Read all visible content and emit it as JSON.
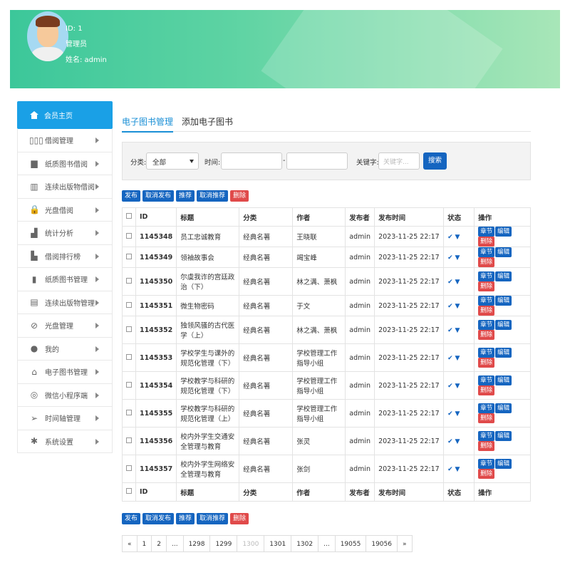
{
  "user": {
    "id_text": "ID: 1",
    "role": "管理员",
    "name_text": "姓名:  admin"
  },
  "sidebar": {
    "home": "会员主页",
    "items": [
      {
        "label": "借阅管理",
        "icon": "books-icon"
      },
      {
        "label": "纸质图书借阅",
        "icon": "book-icon"
      },
      {
        "label": "连续出版物借阅",
        "icon": "shelf-icon"
      },
      {
        "label": "光盘借阅",
        "icon": "lock-icon"
      },
      {
        "label": "统计分析",
        "icon": "chart-icon"
      },
      {
        "label": "借阅排行榜",
        "icon": "ranking-icon"
      },
      {
        "label": "纸质图书管理",
        "icon": "bookmark-icon"
      },
      {
        "label": "连续出版物管理",
        "icon": "doc-edit-icon"
      },
      {
        "label": "光盘管理",
        "icon": "disc-icon"
      },
      {
        "label": "我的",
        "icon": "user-icon"
      },
      {
        "label": "电子图书管理",
        "icon": "open-book-icon"
      },
      {
        "label": "微信小程序端",
        "icon": "wechat-icon"
      },
      {
        "label": "时间轴管理",
        "icon": "send-icon"
      },
      {
        "label": "系统设置",
        "icon": "gear-icon"
      }
    ]
  },
  "tabs": {
    "active": "电子图书管理",
    "second": "添加电子图书"
  },
  "filter": {
    "category_label": "分类:",
    "category_value": "全部",
    "time_label": "时间:",
    "dash": "-",
    "keyword_label": "关键字:",
    "keyword_placeholder": "关键字...",
    "search_button": "搜索"
  },
  "actions": {
    "publish": "发布",
    "unpublish": "取消发布",
    "recommend": "推荐",
    "unrecommend": "取消推荐",
    "delete": "删除"
  },
  "table": {
    "headers": {
      "id": "ID",
      "title": "标题",
      "category": "分类",
      "author": "作者",
      "publisher": "发布者",
      "time": "发布时间",
      "status": "状态",
      "ops": "操作"
    },
    "op_labels": {
      "chapter": "章节",
      "edit": "编辑",
      "delete": "删除"
    },
    "rows": [
      {
        "id": "1145348",
        "title": "员工忠诚教育",
        "category": "经典名著",
        "author": "王晓联",
        "publisher": "admin",
        "time": "2023-11-25 22:17"
      },
      {
        "id": "1145349",
        "title": "领袖故事会",
        "category": "经典名著",
        "author": "竭宝峰",
        "publisher": "admin",
        "time": "2023-11-25 22:17"
      },
      {
        "id": "1145350",
        "title": "尔虞我诈的宫廷政治（下）",
        "category": "经典名著",
        "author": "林之满、萧枫",
        "publisher": "admin",
        "time": "2023-11-25 22:17"
      },
      {
        "id": "1145351",
        "title": "微生物密码",
        "category": "经典名著",
        "author": "于文",
        "publisher": "admin",
        "time": "2023-11-25 22:17"
      },
      {
        "id": "1145352",
        "title": "独领风骚的古代医学（上）",
        "category": "经典名著",
        "author": "林之满、萧枫",
        "publisher": "admin",
        "time": "2023-11-25 22:17"
      },
      {
        "id": "1145353",
        "title": "学校学生与课外的规范化管理（下）",
        "category": "经典名著",
        "author": "学校管理工作指导小组",
        "publisher": "admin",
        "time": "2023-11-25 22:17"
      },
      {
        "id": "1145354",
        "title": "学校教学与科研的规范化管理（下）",
        "category": "经典名著",
        "author": "学校管理工作指导小组",
        "publisher": "admin",
        "time": "2023-11-25 22:17"
      },
      {
        "id": "1145355",
        "title": "学校教学与科研的规范化管理（上）",
        "category": "经典名著",
        "author": "学校管理工作指导小组",
        "publisher": "admin",
        "time": "2023-11-25 22:17"
      },
      {
        "id": "1145356",
        "title": "校内外学生交通安全管理与教育",
        "category": "经典名著",
        "author": "张灵",
        "publisher": "admin",
        "time": "2023-11-25 22:17"
      },
      {
        "id": "1145357",
        "title": "校内外学生网络安全管理与教育",
        "category": "经典名著",
        "author": "张剑",
        "publisher": "admin",
        "time": "2023-11-25 22:17"
      }
    ]
  },
  "pagination": [
    "«",
    "1",
    "2",
    "...",
    "1298",
    "1299",
    "1300",
    "1301",
    "1302",
    "...",
    "19055",
    "19056",
    "»"
  ],
  "pagination_current": "1300"
}
